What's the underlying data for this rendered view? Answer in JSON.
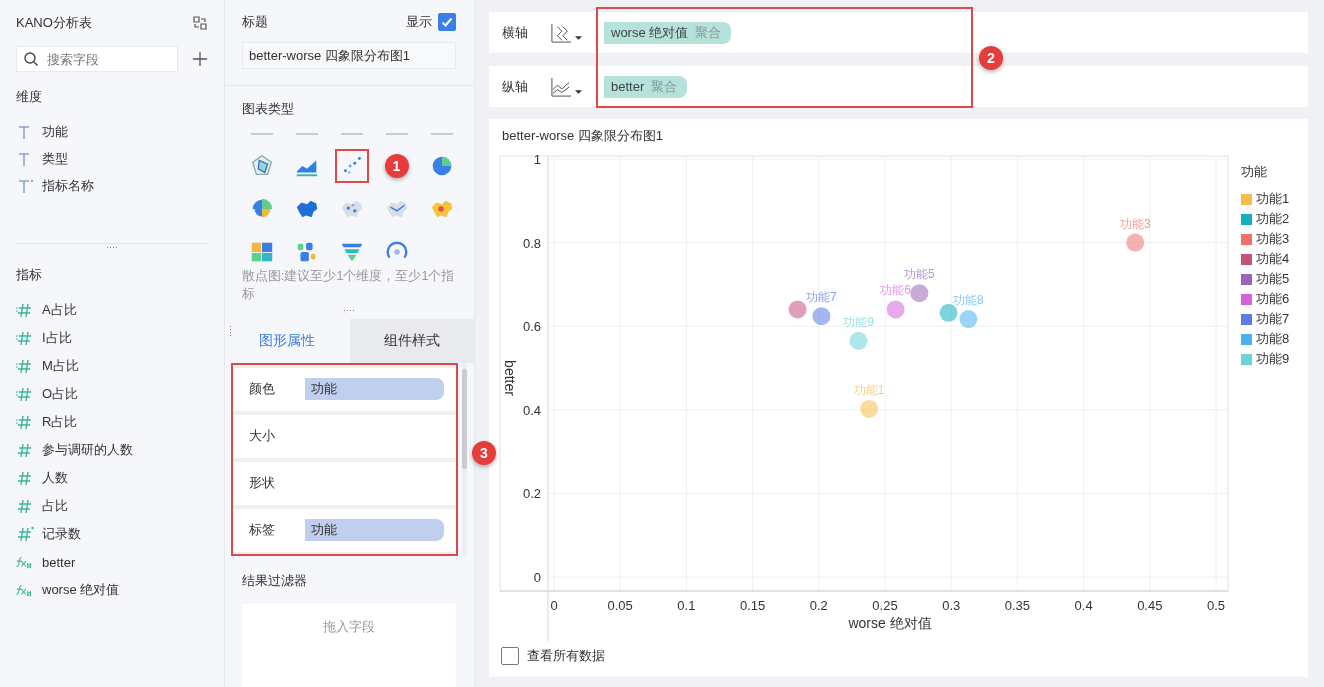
{
  "sidebar": {
    "title": "KANO分析表",
    "search": {
      "placeholder": "搜索字段"
    },
    "dimensions": {
      "heading": "维度",
      "items": [
        {
          "kind": "text",
          "label": "功能"
        },
        {
          "kind": "text",
          "label": "类型"
        },
        {
          "kind": "text-star",
          "label": "指标名称"
        }
      ]
    },
    "measures": {
      "heading": "指标",
      "items": [
        {
          "kind": "ratio",
          "label": "A占比"
        },
        {
          "kind": "ratio",
          "label": "I占比"
        },
        {
          "kind": "ratio",
          "label": "M占比"
        },
        {
          "kind": "ratio",
          "label": "O占比"
        },
        {
          "kind": "ratio",
          "label": "R占比"
        },
        {
          "kind": "number",
          "label": "参与调研的人数"
        },
        {
          "kind": "number",
          "label": "人数"
        },
        {
          "kind": "number",
          "label": "占比"
        },
        {
          "kind": "count",
          "label": "记录数"
        },
        {
          "kind": "formula",
          "label": "better"
        },
        {
          "kind": "formula",
          "label": "worse 绝对值"
        }
      ]
    }
  },
  "settings": {
    "title_label": "标题",
    "show_label": "显示",
    "show_checked": true,
    "title_value": "better-worse 四象限分布图1",
    "chart_type_heading": "图表类型",
    "chart_types": [
      {
        "kind": "partial",
        "selected": false
      },
      {
        "kind": "partial",
        "selected": false
      },
      {
        "kind": "partial",
        "selected": false
      },
      {
        "kind": "partial",
        "selected": false
      },
      {
        "kind": "partial",
        "selected": false
      },
      {
        "kind": "radar",
        "selected": false
      },
      {
        "kind": "area",
        "selected": false
      },
      {
        "kind": "scatter",
        "selected": true
      },
      {
        "kind": "annotation",
        "number": "1"
      },
      {
        "kind": "pie",
        "selected": false
      },
      {
        "kind": "rose",
        "selected": false
      },
      {
        "kind": "map-fill",
        "selected": false
      },
      {
        "kind": "map-dots",
        "selected": false
      },
      {
        "kind": "map-flow",
        "selected": false
      },
      {
        "kind": "map-heat",
        "selected": false
      },
      {
        "kind": "treemap",
        "selected": false
      },
      {
        "kind": "wordcloud",
        "selected": false
      },
      {
        "kind": "funnel",
        "selected": false
      },
      {
        "kind": "gauge",
        "selected": false
      }
    ],
    "chart_type_hint": "散点图:建议至少1个维度，至少1个指标",
    "tabs": [
      {
        "label": "图形属性",
        "selected": true
      },
      {
        "label": "组件样式",
        "selected": false
      }
    ],
    "properties": [
      {
        "label": "颜色",
        "field": "功能"
      },
      {
        "label": "大小"
      },
      {
        "label": "形状"
      },
      {
        "label": "标签",
        "field": "功能"
      }
    ],
    "properties_badge": "3",
    "filter": {
      "heading": "结果过滤器",
      "placeholder": "拖入字段"
    }
  },
  "axes": {
    "badge": "2",
    "rows": [
      {
        "kind": "x",
        "label": "横轴",
        "field": "worse 绝对值",
        "aggregate": "聚合"
      },
      {
        "kind": "y",
        "label": "纵轴",
        "field": "better",
        "aggregate": "聚合"
      }
    ]
  },
  "chart": {
    "title": "better-worse 四象限分布图1",
    "legend_title": "功能",
    "chart_data": {
      "type": "scatter",
      "xlabel": "worse 绝对值",
      "ylabel": "better",
      "xlim": [
        0,
        0.5
      ],
      "ylim": [
        0,
        1
      ],
      "xticks": [
        0,
        0.05,
        0.1,
        0.15,
        0.2,
        0.25,
        0.3,
        0.35,
        0.4,
        0.45,
        0.5
      ],
      "yticks": [
        0,
        0.2,
        0.4,
        0.6,
        0.8,
        1
      ],
      "grid": true,
      "legend": "right",
      "series": [
        {
          "name": "功能1",
          "color": "#f8bb4e",
          "x": [
            0.238
          ],
          "values": [
            0.402
          ]
        },
        {
          "name": "功能2",
          "color": "#14b0c0",
          "x": [
            0.298
          ],
          "values": [
            0.632
          ]
        },
        {
          "name": "功能3",
          "color": "#ef6f6c",
          "x": [
            0.439
          ],
          "values": [
            0.8
          ]
        },
        {
          "name": "功能4",
          "color": "#c2527e",
          "x": [
            0.184
          ],
          "values": [
            0.64
          ]
        },
        {
          "name": "功能5",
          "color": "#9c64b8",
          "x": [
            0.276
          ],
          "values": [
            0.679
          ]
        },
        {
          "name": "功能6",
          "color": "#d464d8",
          "x": [
            0.258
          ],
          "values": [
            0.64
          ]
        },
        {
          "name": "功能7",
          "color": "#5b7be8",
          "x": [
            0.202
          ],
          "values": [
            0.624
          ]
        },
        {
          "name": "功能8",
          "color": "#4ab0f0",
          "x": [
            0.313
          ],
          "values": [
            0.617
          ]
        },
        {
          "name": "功能9",
          "color": "#6ad4d8",
          "x": [
            0.23
          ],
          "values": [
            0.565
          ]
        }
      ],
      "annotations": [
        {
          "text": "功能1",
          "x": 0.238,
          "y": 0.402
        },
        {
          "text": "功能3",
          "x": 0.439,
          "y": 0.8
        },
        {
          "text": "功能5",
          "x": 0.276,
          "y": 0.679
        },
        {
          "text": "功能6",
          "x": 0.258,
          "y": 0.64
        },
        {
          "text": "功能7",
          "x": 0.202,
          "y": 0.624
        },
        {
          "text": "功能8",
          "x": 0.313,
          "y": 0.617
        },
        {
          "text": "功能9",
          "x": 0.23,
          "y": 0.565
        }
      ]
    },
    "show_all": {
      "label": "查看所有数据",
      "checked": false
    }
  }
}
